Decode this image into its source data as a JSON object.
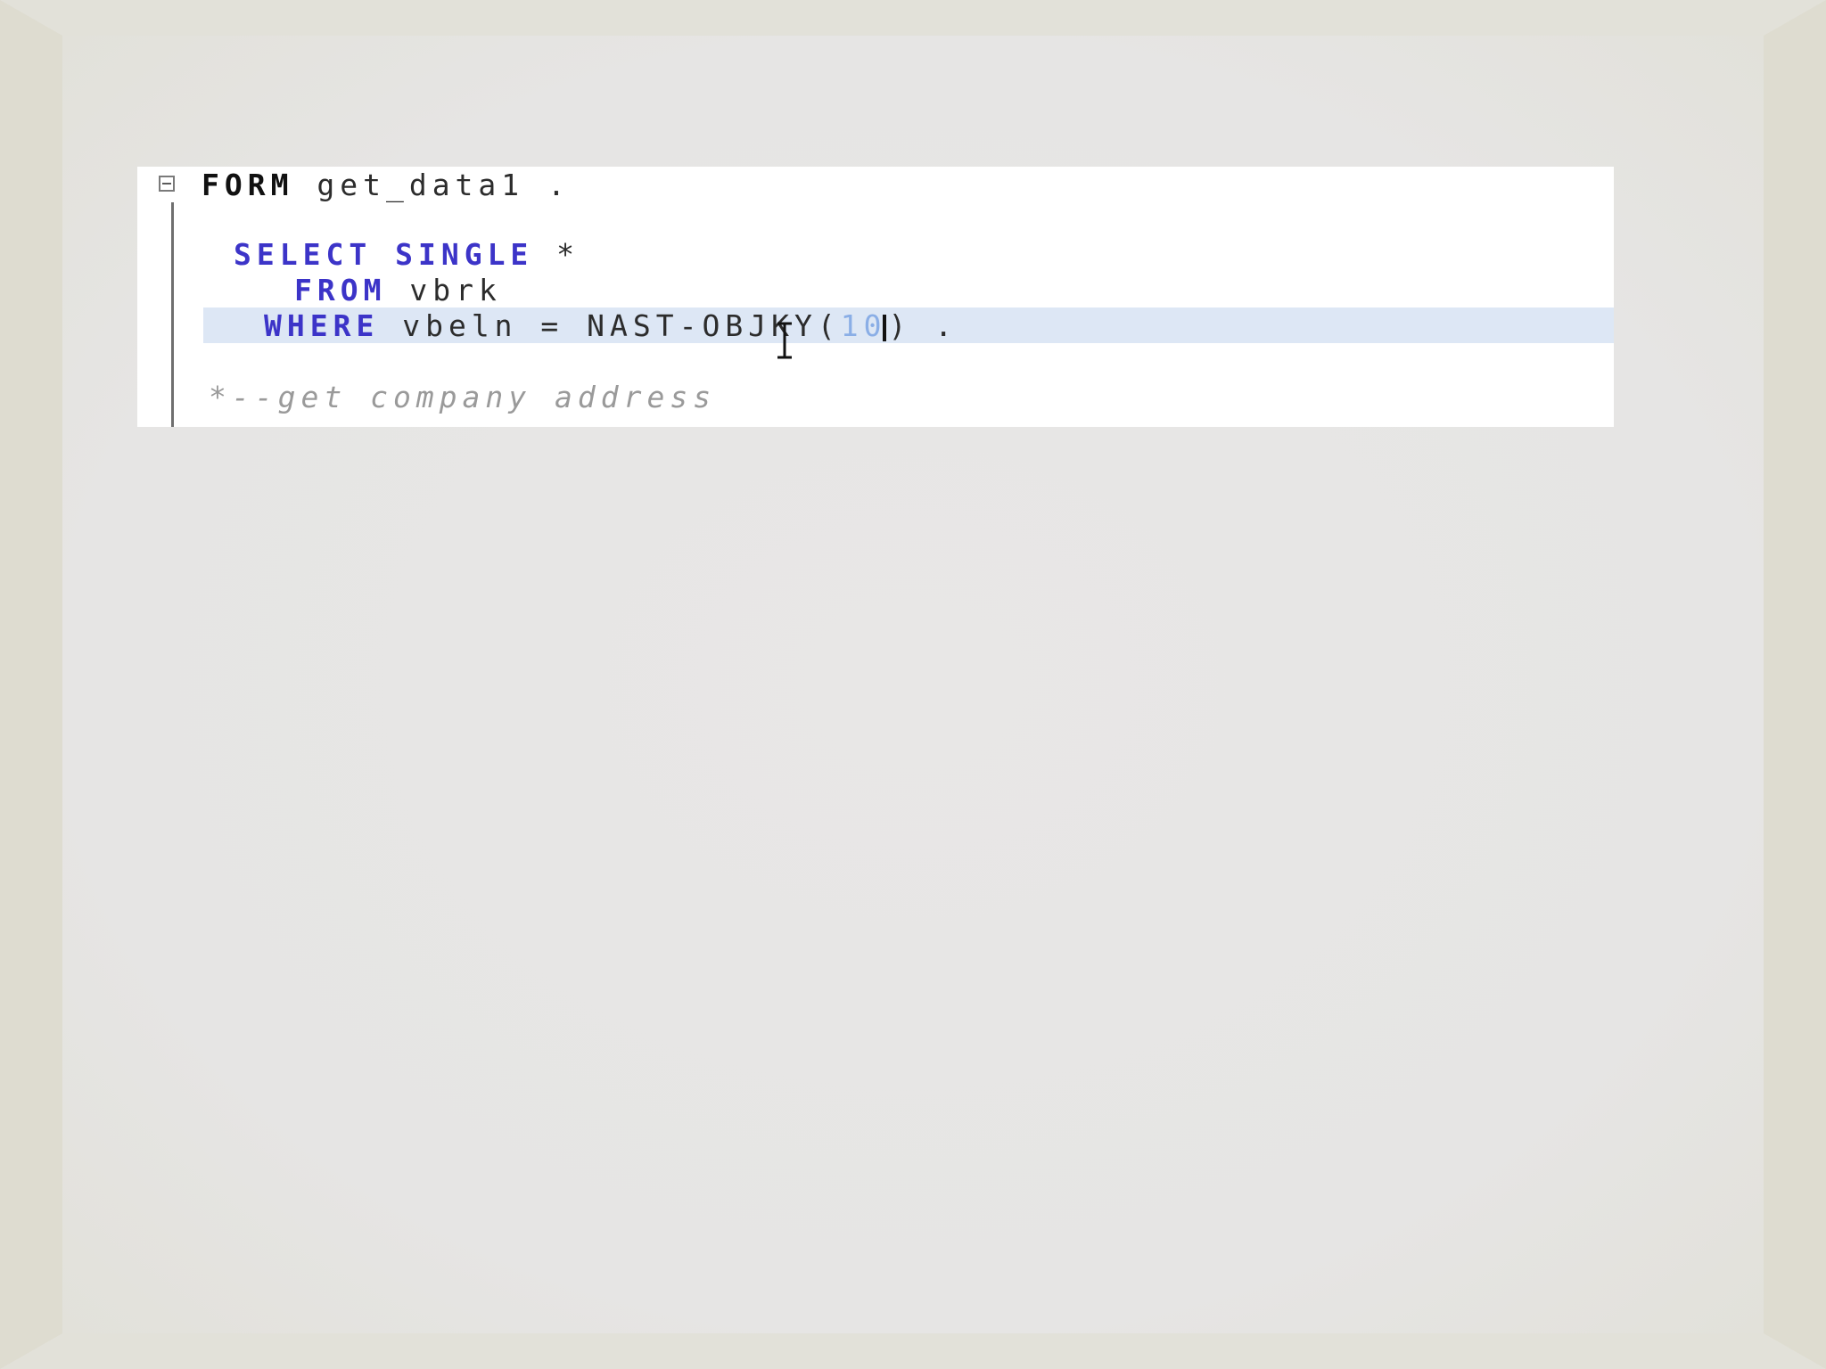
{
  "editor": {
    "lines": {
      "l1": {
        "keyword": "FORM",
        "rest": " get_data1 ."
      },
      "l2": {
        "keyword1": "SELECT",
        "keyword2": "SINGLE",
        "rest": " *"
      },
      "l3": {
        "keyword": "FROM",
        "rest": " vbrk"
      },
      "l4": {
        "keyword": "WHERE",
        "rest": " vbeln = NAST-OBJKY(",
        "number": "10",
        "tail": ") ."
      },
      "l5": {
        "comment": "*--get company address"
      }
    }
  },
  "colors": {
    "keyword_blue": "#3c34c8",
    "keyword_black": "#111111",
    "number_literal": "#8aaee6",
    "comment": "#9a9a9a",
    "current_line_highlight": "#dde7f5",
    "editor_background": "#ffffff",
    "slide_background": "#e7e6e3"
  },
  "icons": {
    "fold": "collapse-minus-icon",
    "cursor": "text-ibeam-cursor-icon"
  }
}
